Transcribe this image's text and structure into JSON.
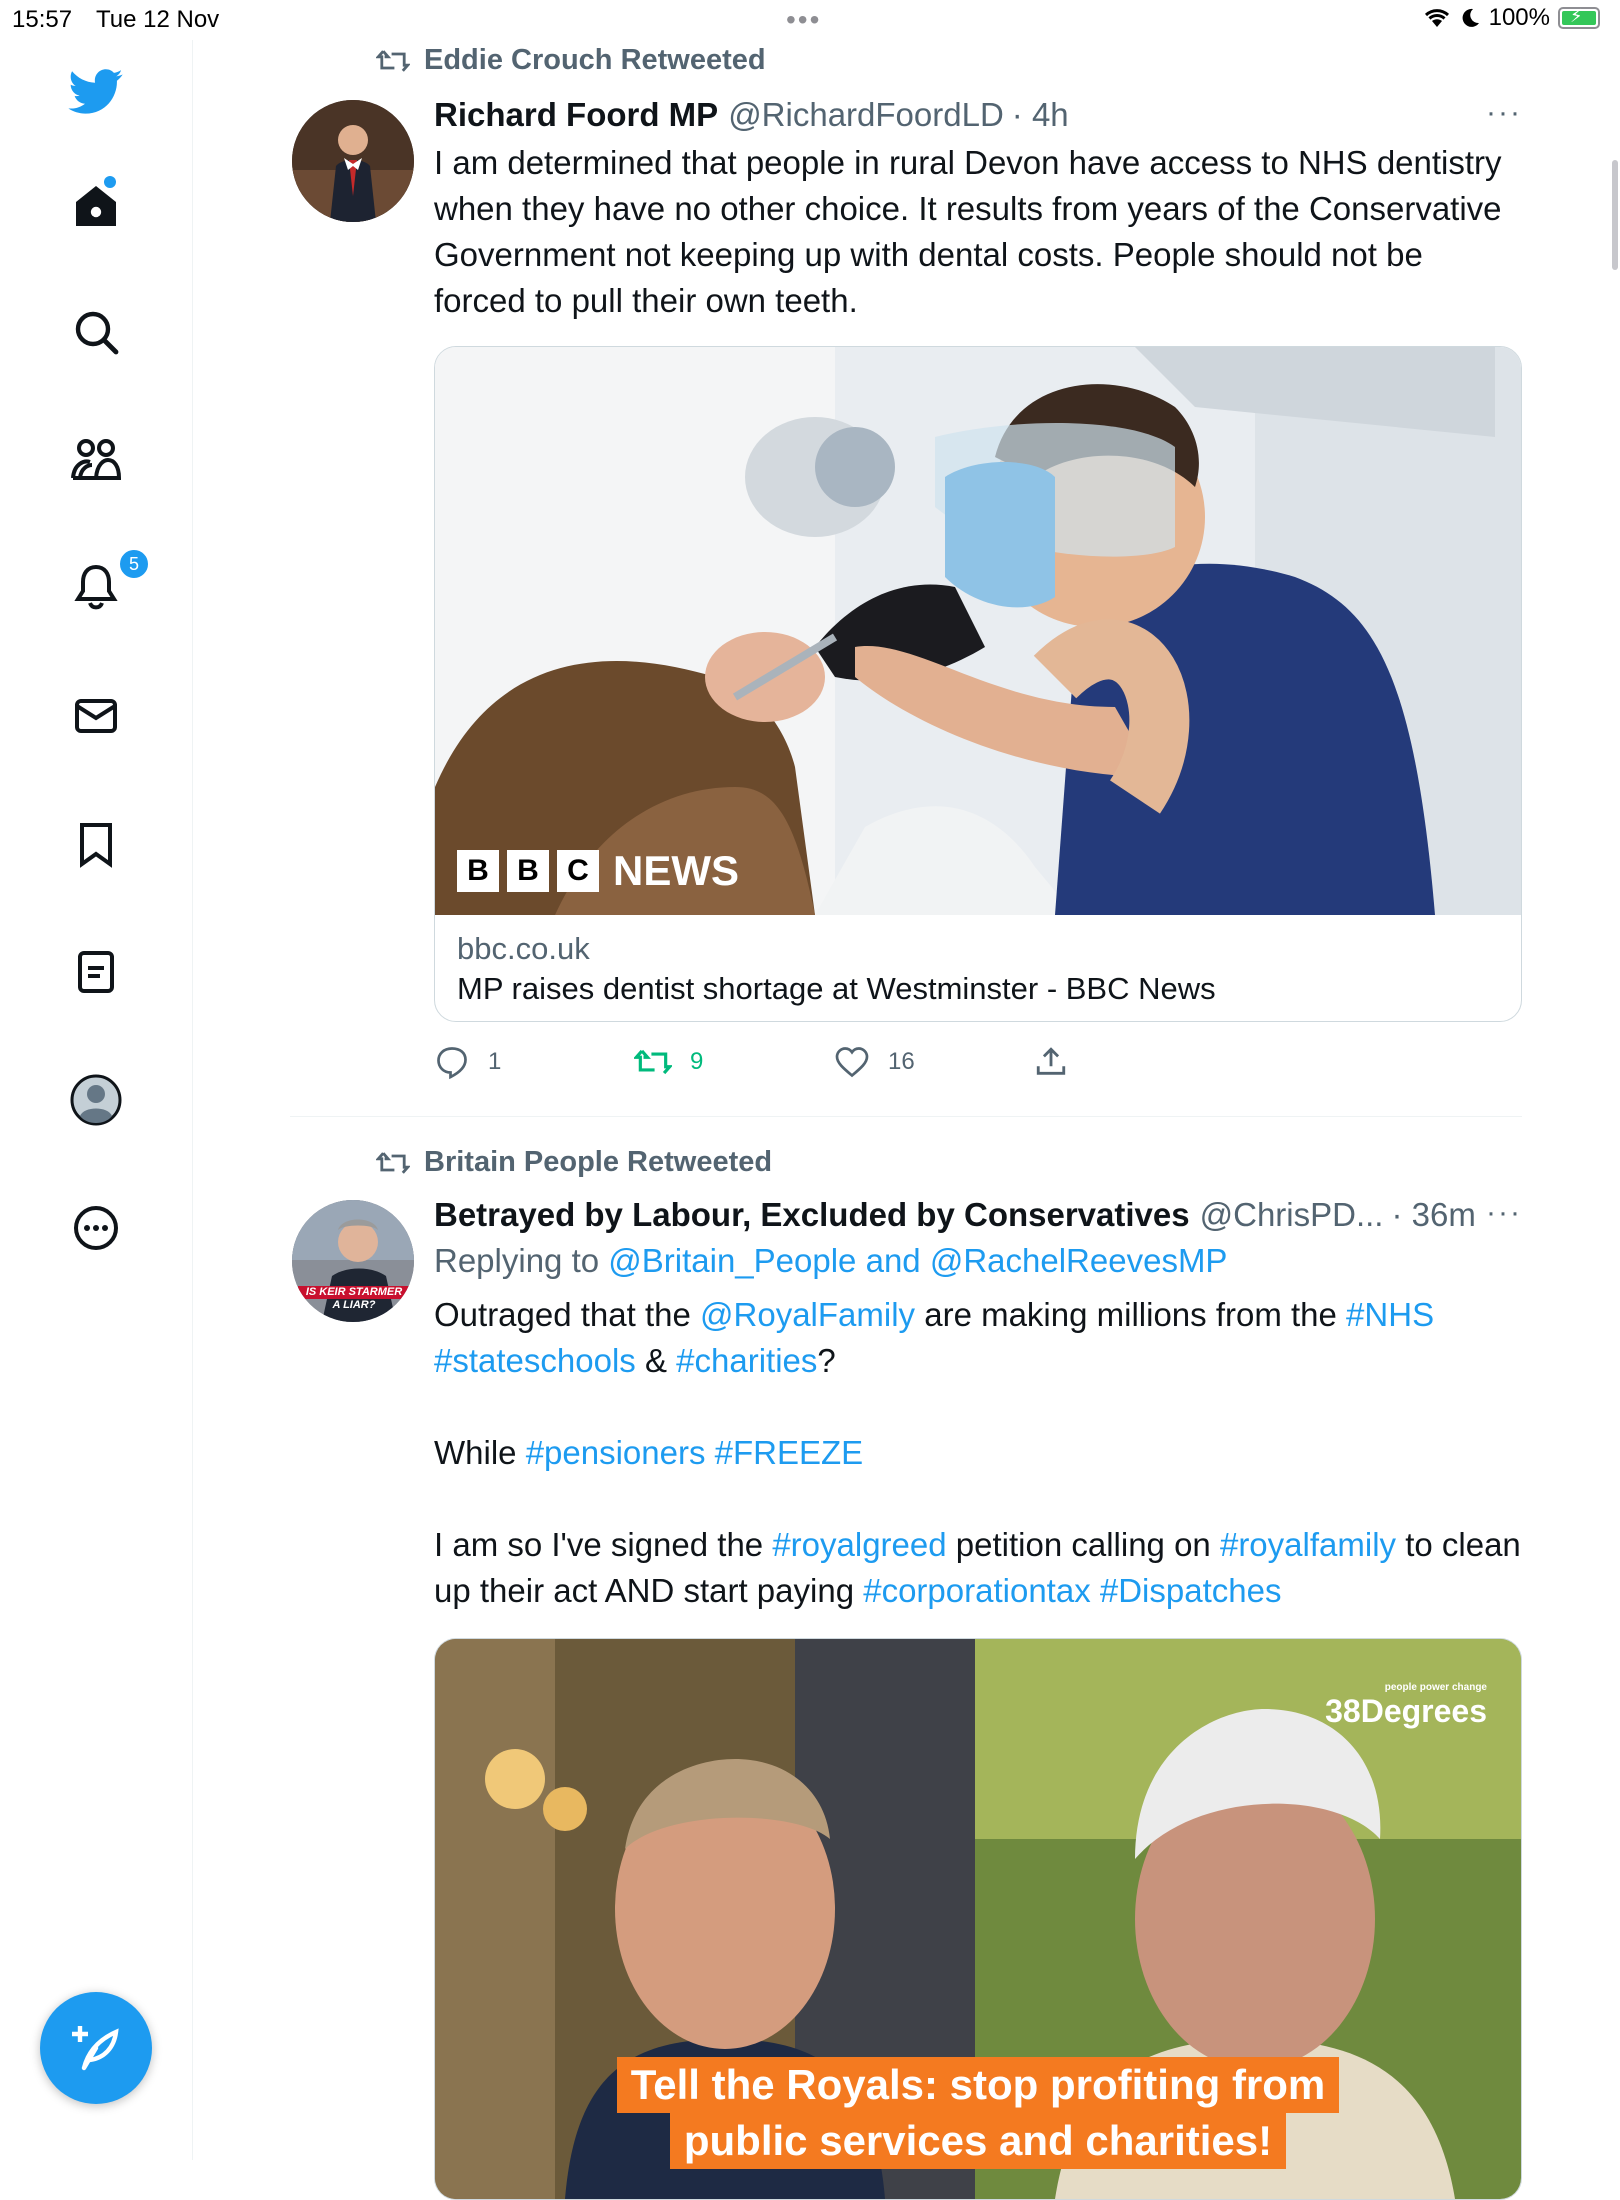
{
  "status_bar": {
    "time": "15:57",
    "date": "Tue 12 Nov",
    "battery": "100%"
  },
  "sidebar": {
    "notifications_badge": "5",
    "items": [
      {
        "name": "home"
      },
      {
        "name": "explore"
      },
      {
        "name": "communities"
      },
      {
        "name": "notifications"
      },
      {
        "name": "messages"
      },
      {
        "name": "bookmarks"
      },
      {
        "name": "lists"
      },
      {
        "name": "profile"
      },
      {
        "name": "more"
      }
    ]
  },
  "tweets": [
    {
      "retweeted_by": "Eddie Crouch Retweeted",
      "author_name": "Richard Foord MP",
      "author_handle": "@RichardFoordLD",
      "time": "· 4h",
      "more": "···",
      "text": "I am determined that people in rural Devon have access to NHS dentistry when they have no other choice. It results from years of the Conservative Government not keeping up with dental costs. People should not be forced to pull their own teeth.",
      "card": {
        "media_logo_letters": [
          "B",
          "B",
          "C"
        ],
        "media_logo_word": "NEWS",
        "domain": "bbc.co.uk",
        "title": "MP raises dentist shortage at Westminster - BBC News"
      },
      "stats": {
        "replies": "1",
        "retweets": "9",
        "likes": "16"
      }
    },
    {
      "retweeted_by": "Britain People Retweeted",
      "author_name": "Betrayed by Labour, Excluded by Conservatives",
      "author_handle": "@ChrisPD...",
      "time": "· 36m",
      "more": "···",
      "avatar_caption_1": "IS KEIR STARMER",
      "avatar_caption_2": "A LIAR?",
      "reply_prefix": "Replying to ",
      "reply_user_1": "@Britain_People",
      "reply_and": " and ",
      "reply_user_2": "@RachelReevesMP",
      "p1": {
        "a": "Outraged that the ",
        "b": "@RoyalFamily",
        "c": " are making millions from the ",
        "d": "#NHS",
        "e": "#stateschools",
        "f": " & ",
        "g": "#charities",
        "h": "?"
      },
      "p2": {
        "a": "While ",
        "b": "#pensioners",
        "c": " ",
        "d": "#FREEZE"
      },
      "p3": {
        "a": "I am so I've signed the ",
        "b": "#royalgreed",
        "c": " petition calling on ",
        "d": "#royalfamily",
        "e": " to clean up their act AND start paying ",
        "f": "#corporationtax",
        "g": " ",
        "h": "#Dispatches"
      },
      "image": {
        "logo": "38Degrees",
        "logo_small": "people power change",
        "banner_1": "Tell the Royals: stop profiting from",
        "banner_2": "public services and charities!"
      }
    }
  ],
  "colors": {
    "accent": "#1d9bf0",
    "retweet_green": "#00ba7c",
    "muted": "#536471",
    "banner_orange": "#f47a20"
  }
}
